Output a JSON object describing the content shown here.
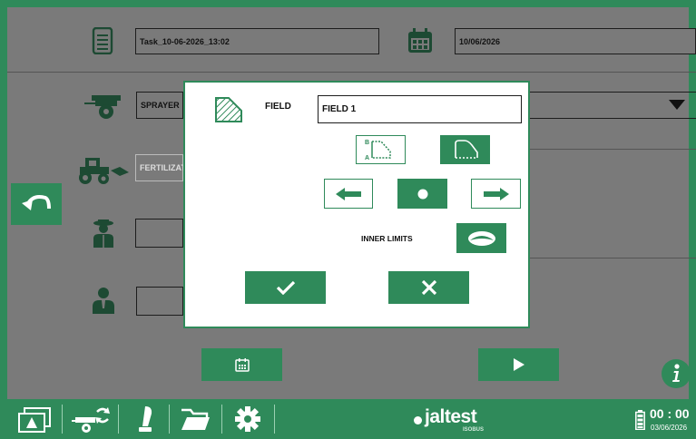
{
  "task": {
    "name": "Task_10-06-2026_13:02",
    "date": "10/06/2026"
  },
  "implement": {
    "value": "SPRAYER"
  },
  "product": {
    "value": "FERTILIZAT"
  },
  "dialog": {
    "field_label": "FIELD",
    "field_value": "FIELD 1",
    "inner_limits_label": "INNER LIMITS"
  },
  "footer": {
    "brand": "jaltest",
    "brand_sub": "ISOBUS",
    "time": "00 : 00",
    "date": "03/06/2026"
  },
  "colors": {
    "accent": "#2f8a5a",
    "background": "#7a7a7a",
    "dark_icon": "#1f5a3c"
  },
  "icons": [
    "document-icon",
    "calendar-icon",
    "trailer-icon",
    "tractor-icon",
    "farmer-icon",
    "person-icon",
    "back-icon",
    "info-icon",
    "field-polygon-icon",
    "ab-line-icon",
    "field-shape-icon",
    "arrow-left-icon",
    "dot-icon",
    "arrow-right-icon",
    "inner-limits-icon",
    "check-icon",
    "close-icon",
    "dropdown-arrow-icon",
    "map-icon",
    "trailer-sync-icon",
    "joystick-icon",
    "folder-icon",
    "gear-icon",
    "battery-icon",
    "play-icon"
  ]
}
